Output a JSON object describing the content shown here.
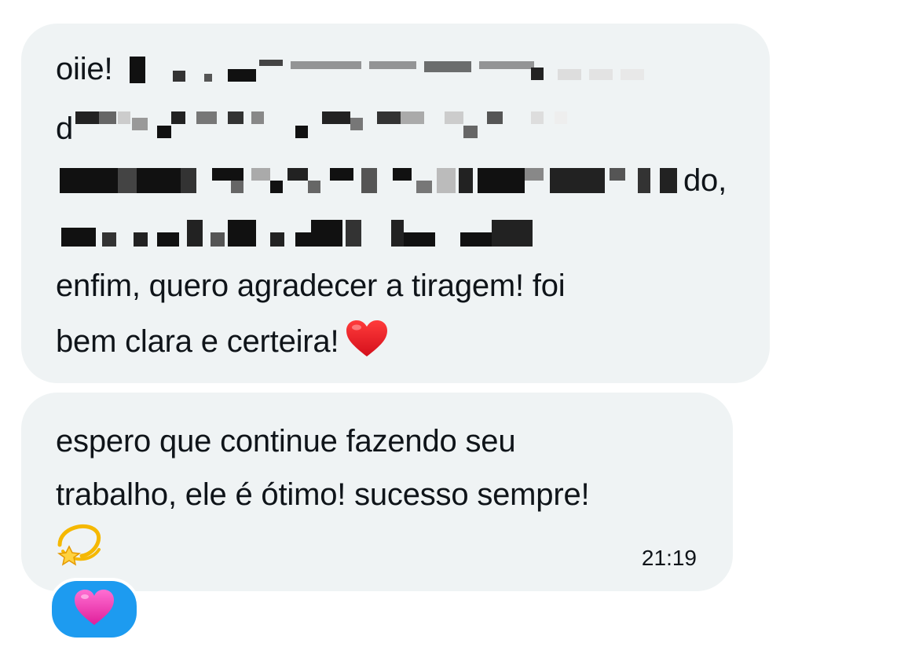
{
  "messages": [
    {
      "lines": [
        "oiie!",
        "d",
        "do,",
        "",
        "enfim, quero agradecer a tiragem! foi",
        "bem clara e certeira!"
      ],
      "trailing_emoji": "red-heart"
    },
    {
      "lines": [
        "espero que continue fazendo seu",
        "trabalho, ele é ótimo! sucesso sempre!"
      ],
      "trailing_emoji": "dizzy-star",
      "time": "21:19"
    }
  ],
  "reaction": {
    "emoji": "pink-heart",
    "bg_color": "#1d9bf0"
  },
  "colors": {
    "bubble": "#eff3f4",
    "text": "#0f1419"
  }
}
